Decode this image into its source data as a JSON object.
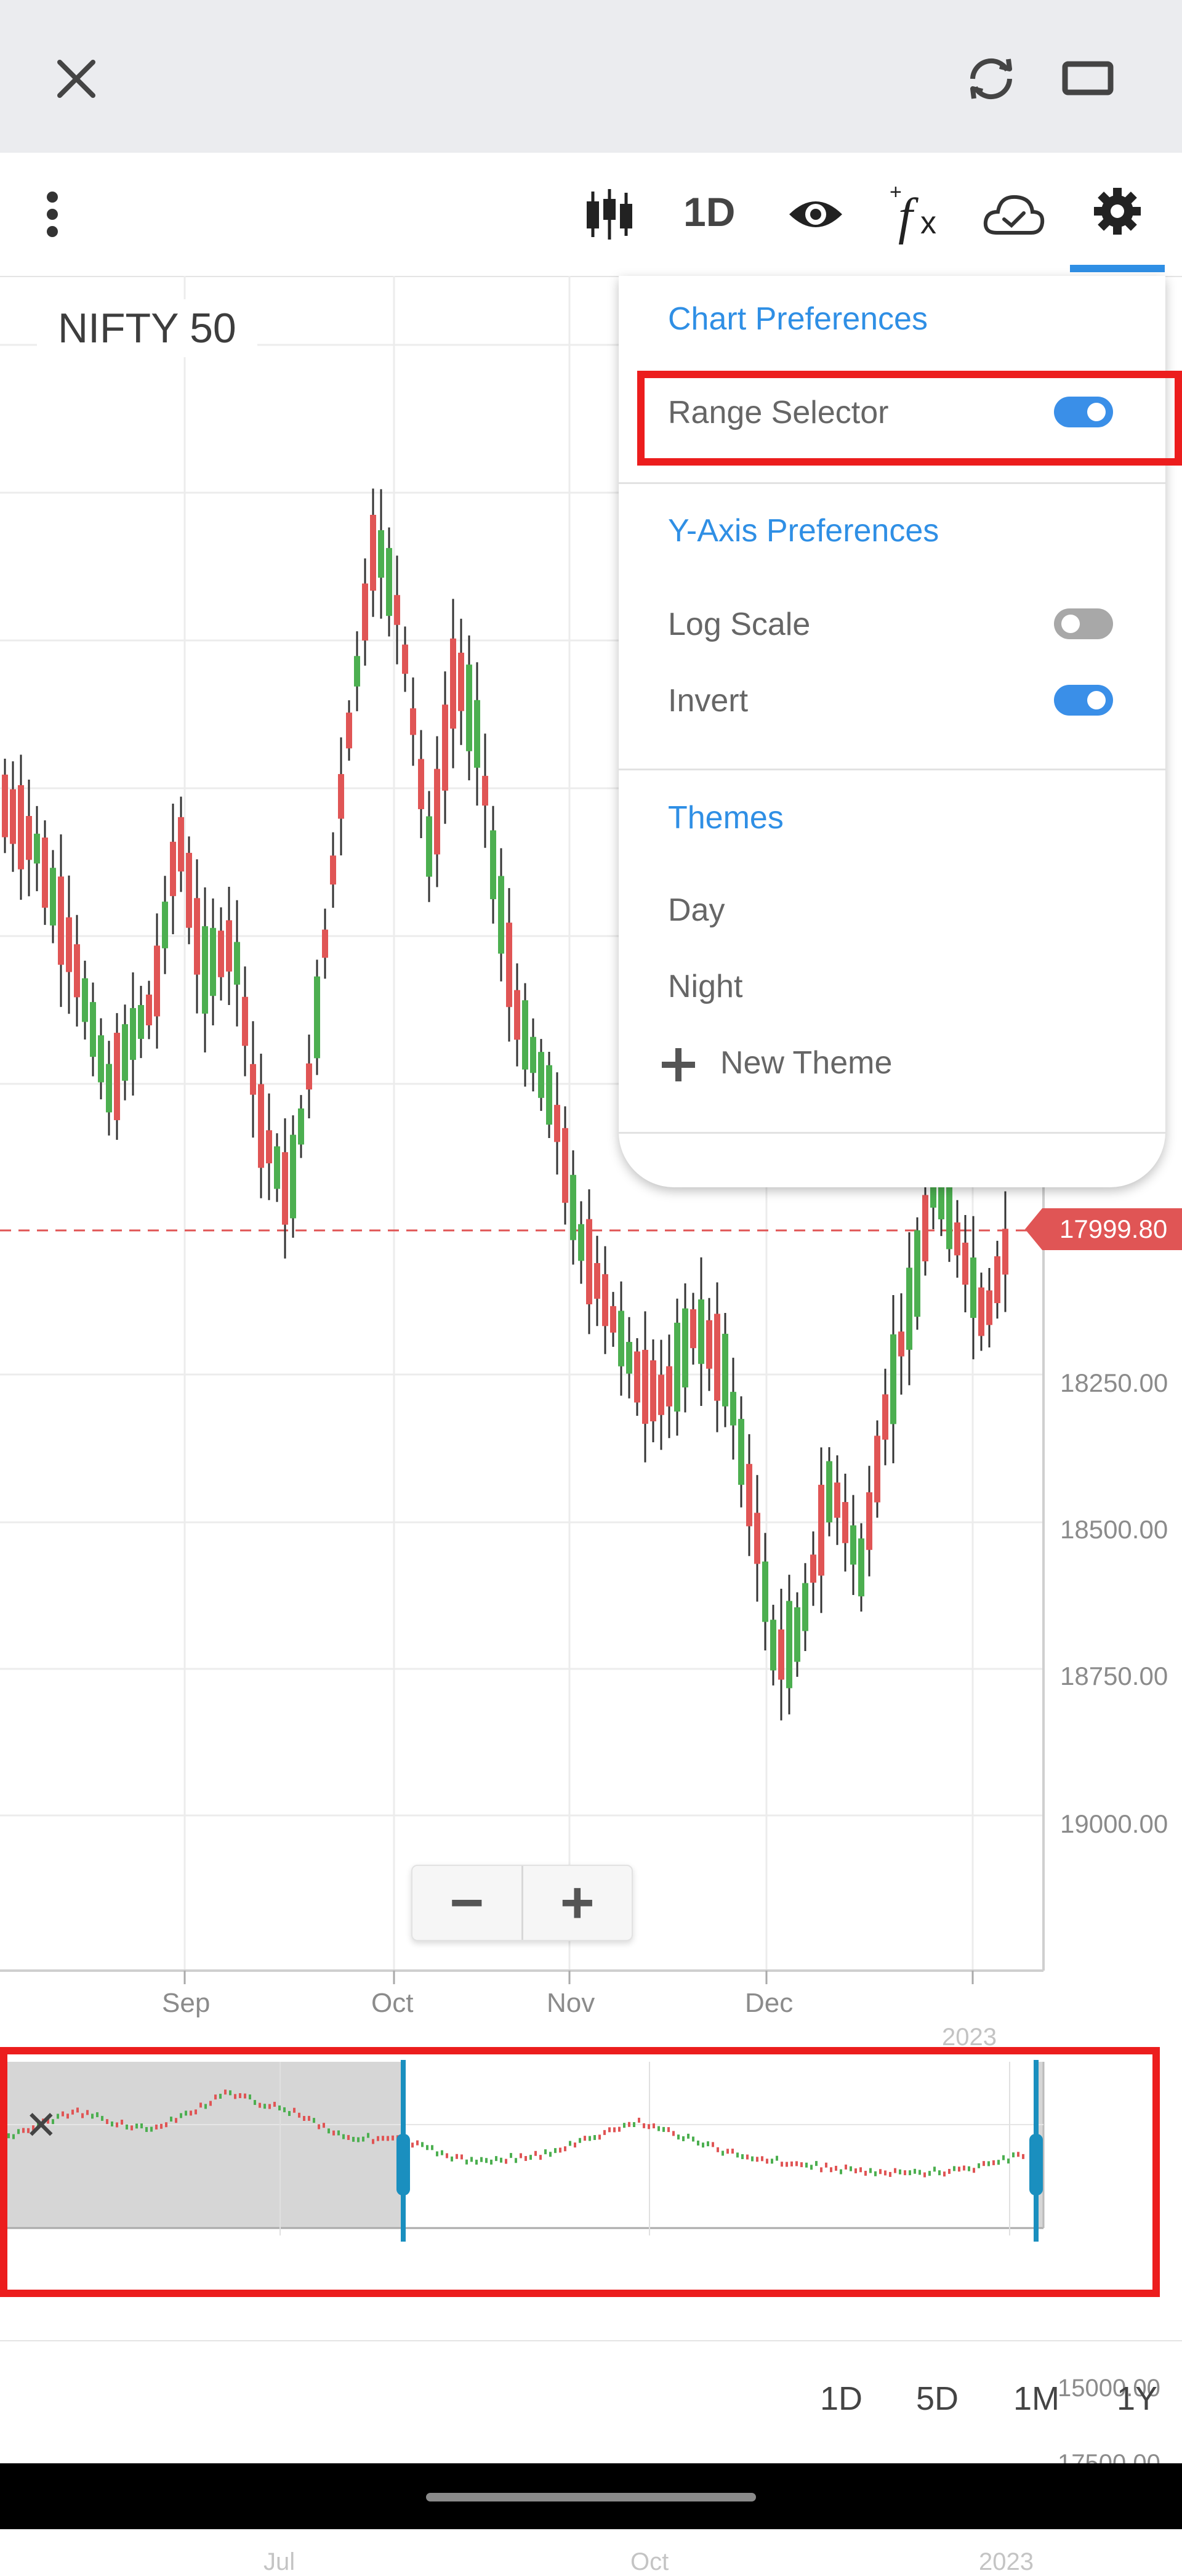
{
  "top_bar": {
    "close_icon": "close-icon",
    "refresh_icon": "refresh-icon",
    "fullscreen_icon": "fullscreen-icon"
  },
  "toolbar": {
    "more_icon": "more-vertical-icon",
    "chart_type_icon": "candlestick-icon",
    "interval_label": "1D",
    "eye_icon": "eye-icon",
    "studies_icon": "fx-icon",
    "cloud_icon": "cloud-check-icon",
    "settings_icon": "gear-icon",
    "active_tab_color": "#2f8fe5"
  },
  "chart": {
    "symbol": "NIFTY 50",
    "current_price_label": "17999.80",
    "y_labels": [
      "18250.00",
      "18500.00",
      "18750.00",
      "19000.00"
    ],
    "x_labels": [
      "Sep",
      "Oct",
      "Nov",
      "Dec",
      "2023"
    ],
    "up_color": "#4caf50",
    "down_color": "#e05555",
    "price_tag_color": "#e05555",
    "y_axis": "inverted",
    "zoom_out_label": "−",
    "zoom_in_label": "+"
  },
  "range_selector": {
    "close_label": "✕",
    "y_labels": [
      "15000.00",
      "17500.00"
    ],
    "x_labels": [
      "Jul",
      "Oct",
      "2023"
    ],
    "handle_color": "#1a8fbf",
    "unselected_fill": "#d6d6d6"
  },
  "preferences_menu": {
    "chart_prefs_title": "Chart Preferences",
    "range_selector_label": "Range Selector",
    "range_selector_on": true,
    "y_axis_title": "Y-Axis Preferences",
    "log_scale_label": "Log Scale",
    "log_scale_on": false,
    "invert_label": "Invert",
    "invert_on": true,
    "themes_title": "Themes",
    "theme_day": "Day",
    "theme_night": "Night",
    "new_theme_label": "New Theme",
    "plus_icon": "plus-icon"
  },
  "periods": [
    "1D",
    "5D",
    "1M",
    "1Y"
  ],
  "highlight_color": "#ec1d1d"
}
